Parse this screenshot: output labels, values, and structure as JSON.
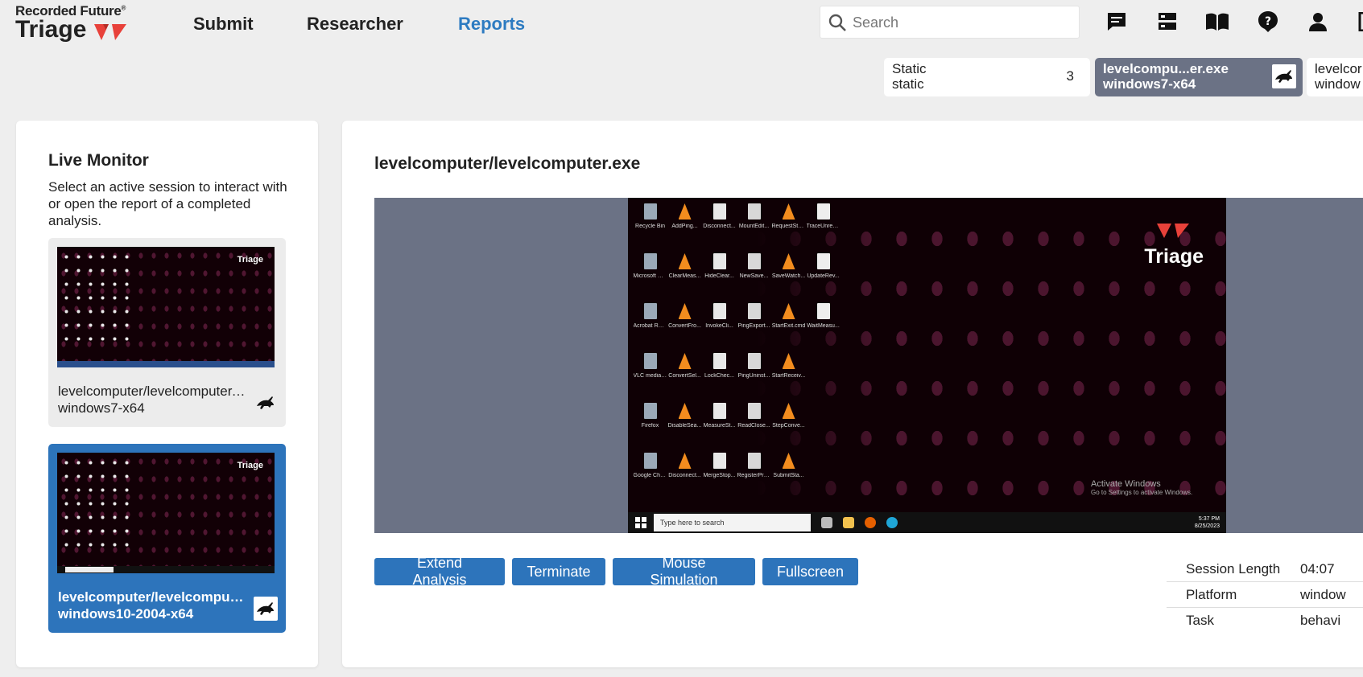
{
  "brand": {
    "line1": "Recorded Future",
    "line2": "Triage",
    "reg": "®"
  },
  "nav": {
    "submit": "Submit",
    "researcher": "Researcher",
    "reports": "Reports"
  },
  "search": {
    "placeholder": "Search"
  },
  "header_icons": [
    "chat-icon",
    "server-icon",
    "book-icon",
    "help-icon",
    "user-icon",
    "logout-icon"
  ],
  "task_tabs": [
    {
      "line1": "Static",
      "line2": "static",
      "count": "3"
    },
    {
      "line1": "levelcompu...er.exe",
      "line2": "windows7-x64"
    },
    {
      "line1": "levelcor",
      "line2": "window"
    }
  ],
  "live_monitor": {
    "title": "Live Monitor",
    "description": "Select an active session to interact with or open the report of a completed analysis.",
    "sessions": [
      {
        "name": "levelcomputer/levelcomputer.exe",
        "platform": "windows7-x64"
      },
      {
        "name": "levelcomputer/levelcomputer.exe",
        "platform": "windows10-2004-x64"
      }
    ]
  },
  "main": {
    "title": "levelcomputer/levelcomputer.exe",
    "desktop": {
      "logo": "Triage",
      "activate_title": "Activate Windows",
      "activate_sub": "Go to Settings to activate Windows.",
      "taskbar_search": "Type here to search",
      "clock_time": "5:37 PM",
      "clock_date": "8/25/2023",
      "icons": [
        "Recycle Bin",
        "AddPing...",
        "Disconnect...",
        "MountEdit...",
        "RequestSto...",
        "TraceUnregi...",
        "Microsoft Edge",
        "ClearMeas...",
        "HideClear...",
        "NewSave...",
        "SaveWatch...",
        "UpdateRev...",
        "Acrobat Reader DC",
        "ConvertFro...",
        "InvokeCli...",
        "PingExport...",
        "StartExit.cmd",
        "WaitMeasu...",
        "VLC media player",
        "ConvertSel...",
        "LockChec...",
        "PingUninst...",
        "StartReceiv...",
        "",
        "Firefox",
        "DisableSea...",
        "MeasureSt...",
        "ReadClose...",
        "StepConve...",
        "",
        "Google Chrome",
        "Disconnect...",
        "MergeStop...",
        "RegisterPro...",
        "SubmitSta...",
        ""
      ]
    },
    "buttons": {
      "extend": "Extend Analysis",
      "terminate": "Terminate",
      "mouse": "Mouse Simulation",
      "fullscreen": "Fullscreen"
    },
    "info": [
      {
        "key": "Session Length",
        "value": "04:07"
      },
      {
        "key": "Platform",
        "value": "window"
      },
      {
        "key": "Task",
        "value": "behavi"
      }
    ]
  },
  "colors": {
    "accent": "#2d74bb",
    "link": "#2d7bc1",
    "brand_red": "#e8413a",
    "selected_tab": "#6b7285"
  }
}
